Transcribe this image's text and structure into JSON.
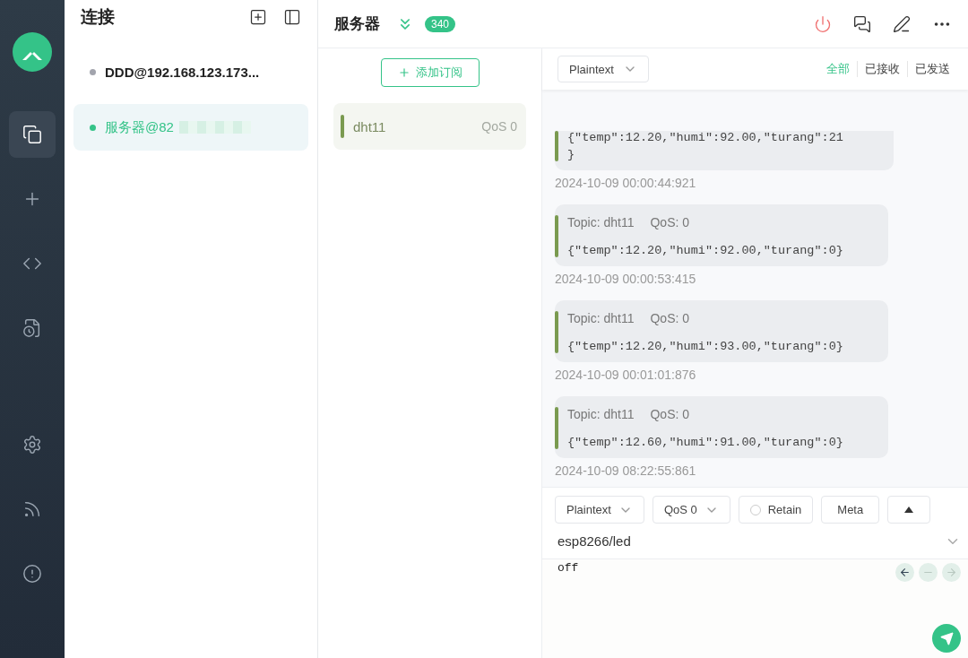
{
  "sidebar": {
    "items": [
      {
        "selected": true
      },
      {
        "selected": false
      },
      {
        "selected": false
      },
      {
        "selected": false
      },
      {
        "selected": false
      },
      {
        "selected": false
      },
      {
        "selected": false
      }
    ]
  },
  "connections": {
    "title": "连接",
    "items": [
      {
        "name": "DDD@192.168.123.173...",
        "connected": false,
        "selected": false,
        "redacted": false
      },
      {
        "name": "服务器@82",
        "connected": true,
        "selected": true,
        "redacted": true
      }
    ]
  },
  "header": {
    "title": "服务器",
    "count": "340"
  },
  "subscriptions": {
    "add_button": "添加订阅",
    "items": [
      {
        "topic": "dht11",
        "qos": "QoS 0",
        "color": "#7a9a50"
      }
    ]
  },
  "messages": {
    "format": "Plaintext",
    "filters": [
      {
        "label": "全部",
        "selected": true
      },
      {
        "label": "已接收",
        "selected": false
      },
      {
        "label": "已发送",
        "selected": false
      }
    ],
    "items": [
      {
        "kind": "partial",
        "lines": [
          "{\"temp\":12.20,\"humi\":92.00,\"turang\":21",
          "}"
        ],
        "time": "2024-10-09 00:00:44:921"
      },
      {
        "kind": "full",
        "topic": "Topic: dht11",
        "qos": "QoS: 0",
        "payload": "{\"temp\":12.20,\"humi\":92.00,\"turang\":0}",
        "time": "2024-10-09 00:00:53:415"
      },
      {
        "kind": "full",
        "topic": "Topic: dht11",
        "qos": "QoS: 0",
        "payload": "{\"temp\":12.20,\"humi\":93.00,\"turang\":0}",
        "time": "2024-10-09 00:01:01:876"
      },
      {
        "kind": "full",
        "topic": "Topic: dht11",
        "qos": "QoS: 0",
        "payload": "{\"temp\":12.60,\"humi\":91.00,\"turang\":0}",
        "time": "2024-10-09 08:22:55:861"
      }
    ]
  },
  "publish": {
    "format": "Plaintext",
    "qos": "QoS 0",
    "retain": {
      "label": "Retain",
      "checked": false
    },
    "meta": "Meta",
    "topic": "esp8266/led",
    "payload": "off"
  }
}
